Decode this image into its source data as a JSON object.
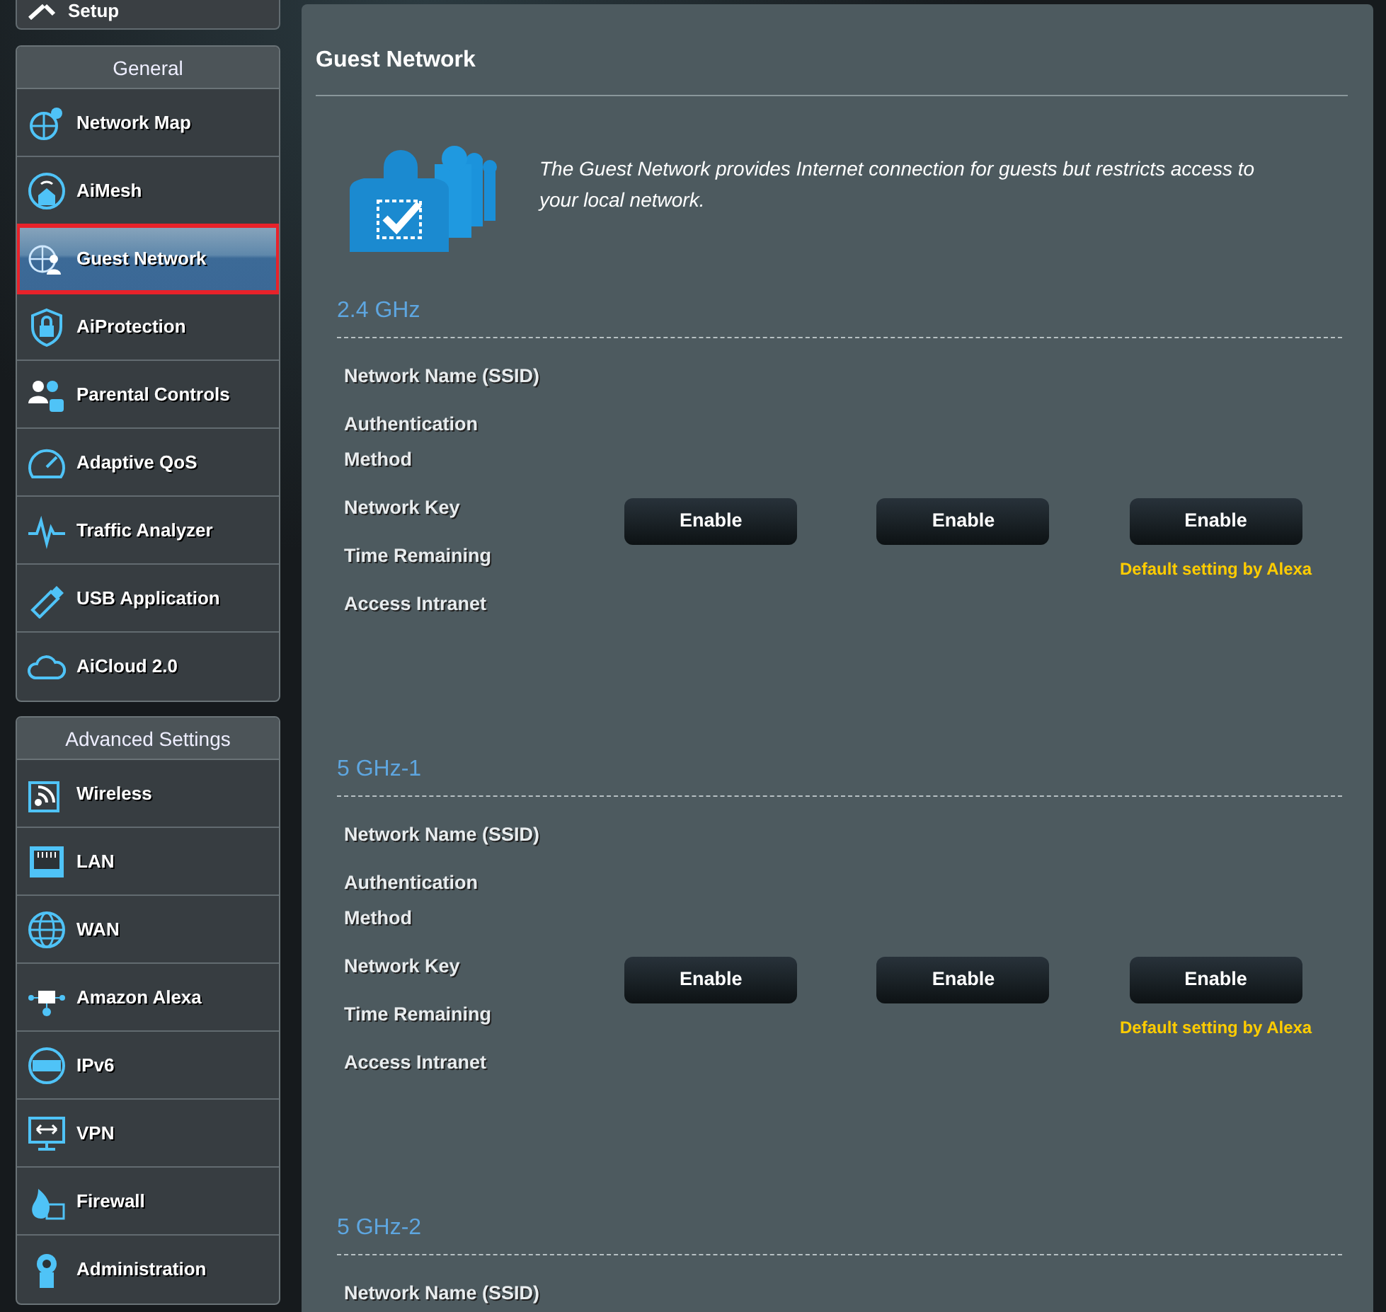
{
  "sidebar": {
    "top_item": {
      "label": "Setup"
    },
    "groups": [
      {
        "title": "General",
        "items": [
          {
            "label": "Network Map",
            "selected": false
          },
          {
            "label": "AiMesh",
            "selected": false
          },
          {
            "label": "Guest Network",
            "selected": true
          },
          {
            "label": "AiProtection",
            "selected": false
          },
          {
            "label": "Parental Controls",
            "selected": false
          },
          {
            "label": "Adaptive QoS",
            "selected": false
          },
          {
            "label": "Traffic Analyzer",
            "selected": false
          },
          {
            "label": "USB Application",
            "selected": false
          },
          {
            "label": "AiCloud 2.0",
            "selected": false
          }
        ]
      },
      {
        "title": "Advanced Settings",
        "items": [
          {
            "label": "Wireless",
            "selected": false
          },
          {
            "label": "LAN",
            "selected": false
          },
          {
            "label": "WAN",
            "selected": false
          },
          {
            "label": "Amazon Alexa",
            "selected": false
          },
          {
            "label": "IPv6",
            "selected": false
          },
          {
            "label": "VPN",
            "selected": false
          },
          {
            "label": "Firewall",
            "selected": false
          },
          {
            "label": "Administration",
            "selected": false
          }
        ]
      }
    ]
  },
  "main": {
    "title": "Guest Network",
    "intro": "The Guest Network provides Internet connection for guests but restricts access to your local network.",
    "bands": [
      {
        "name": "2.4 GHz",
        "fields": [
          "Network Name (SSID)",
          "Authentication Method",
          "Network Key",
          "Time Remaining",
          "Access Intranet"
        ],
        "slots": [
          {
            "button": "Enable"
          },
          {
            "button": "Enable"
          },
          {
            "button": "Enable",
            "note": "Default setting by Alexa"
          }
        ]
      },
      {
        "name": "5 GHz-1",
        "fields": [
          "Network Name (SSID)",
          "Authentication Method",
          "Network Key",
          "Time Remaining",
          "Access Intranet"
        ],
        "slots": [
          {
            "button": "Enable"
          },
          {
            "button": "Enable"
          },
          {
            "button": "Enable",
            "note": "Default setting by Alexa"
          }
        ]
      },
      {
        "name": "5 GHz-2",
        "fields": [
          "Network Name (SSID)"
        ]
      }
    ]
  }
}
